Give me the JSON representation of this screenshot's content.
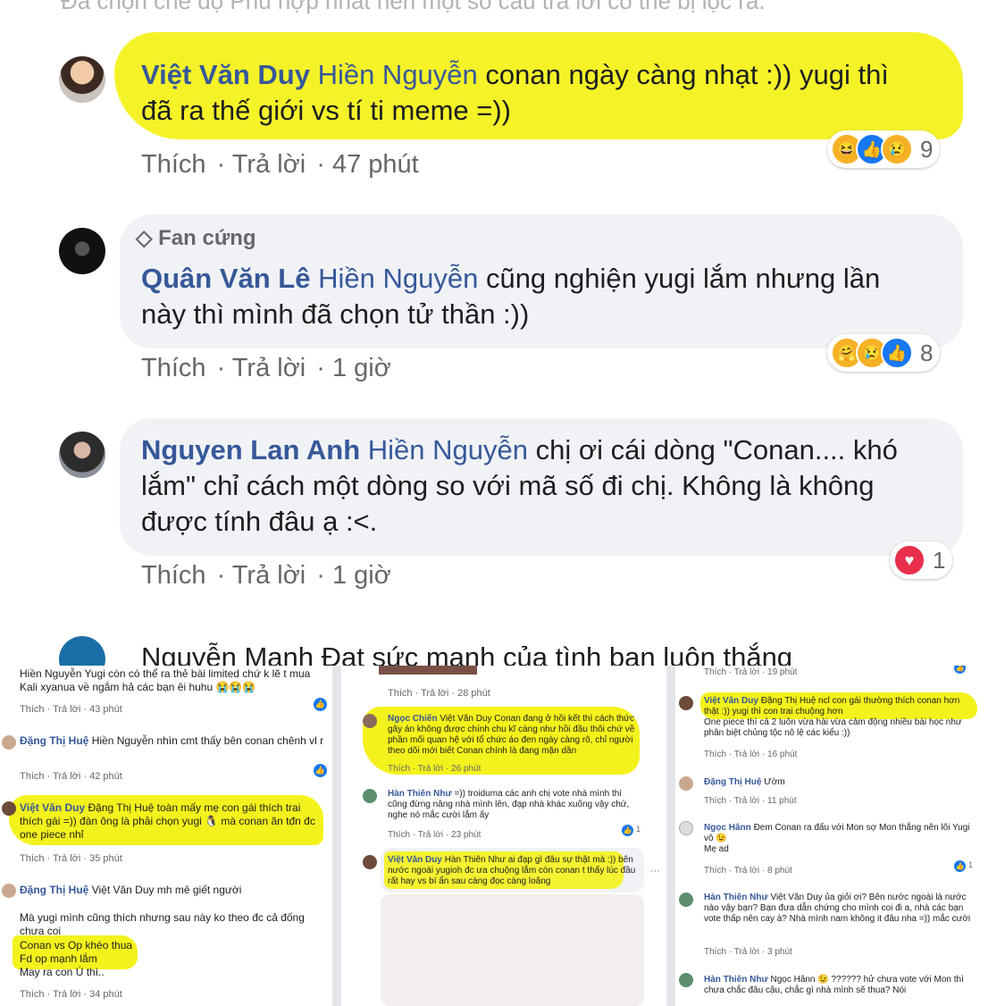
{
  "top": {
    "banner": "Đã chọn chế độ Phù hợp nhất nên một số câu trả lời có thể bị lọc ra.",
    "comments": [
      {
        "author": "Việt Văn Duy",
        "mention": "Hiền Nguyễn",
        "text_line1": "conan ngày càng nhạt :)) yugi thì",
        "text_line2": "đã ra thế giới vs tí ti meme =))",
        "like": "Thích",
        "reply": "Trả lời",
        "time": "47 phút",
        "reaction_count": "9"
      },
      {
        "badge": "Fan cứng",
        "author": "Quân Văn Lê",
        "mention": "Hiền Nguyễn",
        "text_line1": "cũng nghiện yugi lắm nhưng lần",
        "text_line2": "này thì mình đã chọn tử thần :))",
        "like": "Thích",
        "reply": "Trả lời",
        "time": "1 giờ",
        "reaction_count": "8"
      },
      {
        "author": "Nguyen Lan Anh",
        "mention": "Hiền Nguyễn",
        "text_line1": "chị ơi cái dòng \"Conan.... khó",
        "text_line2": "lắm\" chỉ cách một dòng so với mã số đi chị. Không là không",
        "text_line3": "được tính đâu ạ :<.",
        "like": "Thích",
        "reply": "Trả lời",
        "time": "1 giờ",
        "reaction_count": "1"
      }
    ],
    "cutoff_text": "Nguyễn Mạnh Đạt sức mạnh của tình bạn luôn thắng"
  },
  "left_panel": {
    "c1_line1": "Hiền Nguyễn Yugi còn có thể ra thẻ bài limited chứ k lẽ t mua",
    "c1_line2": "Kali xyanua về ngắm hả các bạn êi huhu 😭😭😭",
    "c1_meta": "Thích · Trả lời · 43 phút",
    "c2_author": "Đặng Thị Huệ",
    "c2_text": "Hiền Nguyễn nhìn cmt thấy bên conan chênh vl r",
    "c2_meta": "Thích · Trả lời · 42 phút",
    "c3_author": "Việt Văn Duy",
    "c3_text": "Đặng Thị Huệ toàn mấy mẹ con gái thích trai thích gái =)) đàn ông là phải chọn yugi 🐧 mà conan ăn tđn đc one piece nhỉ",
    "c3_meta": "Thích · Trả lời · 35 phút",
    "c4_author": "Đặng Thị Huệ",
    "c4_mention": "Việt Văn Duy",
    "c4_line1": "mh mê giết người",
    "c4_line2": "Mà yugi mình cũng thích nhưng sau này ko theo đc cả đống chưa coi",
    "c4_line3": "Conan vs Op khéo thua",
    "c4_line4": "Fd op mạnh lắm",
    "c4_line5": "May ra con Ú thì..",
    "c4_meta": "Thích · Trả lời · 34 phút"
  },
  "mid_panel": {
    "meta0": "Thích · Trả lời · 28 phút",
    "c1_author": "Ngọc Chiến",
    "c1_text": "Việt Văn Duy Conan đang ở hồi kết thì cách thức gây án không được chính chu kĩ càng như hồi đầu thôi chứ về phần mối quan hệ với tổ chức áo đen ngày càng rõ, chỉ người theo dõi mới biết Conan chính là đang mặn dần",
    "c1_meta": "Thích · Trả lời · 26 phút",
    "c2_author": "Hàn Thiên Như",
    "c2_text": "=)) troiduma các anh chị vote nhà mình thì cũng đừng nâng nhà mình lên, đạp nhà khác xuống vậy chứ, nghe nó mắc cười lắm ấy",
    "c2_meta": "Thích · Trả lời · 23 phút",
    "c2_count": "1",
    "c3_author": "Việt Văn Duy",
    "c3_text": "Hàn Thiên Như ai đạp gì đâu sự thật mà :)) bên nước ngoài yugioh đc ưa chuộng lắm còn conan t thấy lúc đầu rất hay vs bí ẩn sau càng đọc càng loãng",
    "more": "···"
  },
  "right_panel": {
    "meta0": "Thích · Trả lời · 19 phút",
    "c1_author": "Việt Văn Duy",
    "c1_text": "Đặng Thị Huệ ncl con gái thường thích conan hơn thật :)) yugi thì con trai chuộng hơn",
    "c1_text2": "One piece thì cả 2 luôn vừa hài vừa cảm động nhiều bài học như phân biệt chủng tộc nô lệ các kiểu :))",
    "c1_meta": "Thích · Trả lời · 16 phút",
    "c2_author": "Đặng Thị Huệ",
    "c2_text": "Ườm",
    "c2_meta": "Thích · Trả lời · 11 phút",
    "c3_author": "Ngọc Hânn",
    "c3_text": "Đem Conan ra đấu với Mon sợ Mon thắng nên lôi Yugi vô 😉",
    "c3_text2": "Mẹ ad",
    "c3_meta": "Thích · Trả lời · 8 phút",
    "c3_count": "1",
    "c4_author": "Hàn Thiên Như",
    "c4_text": "Việt Văn Duy ủa giỏi ơi? Bên nước ngoài là nước nào vậy bạn? Bạn đưa dẫn chứng cho mình coi đi a, nhà các bạn vote thấp nên cay à? Nhà mình nam không it đâu nha =)) mắc cười",
    "c4_meta": "Thích · Trả lời · 3 phút",
    "c5_author": "Hàn Thiên Như",
    "c5_text": "Ngọc Hânn 😉 ?????? hử chưa vote với Mon thì chưa chắc đâu cậu, chắc gì nhà mình sẽ thua? Nói"
  },
  "colors": {
    "highlight": "#f4f21c",
    "name": "#365899",
    "bubble": "#f0f2f5",
    "meta": "#65676b",
    "like_blue": "#1877f2",
    "love_red": "#e8304d"
  }
}
